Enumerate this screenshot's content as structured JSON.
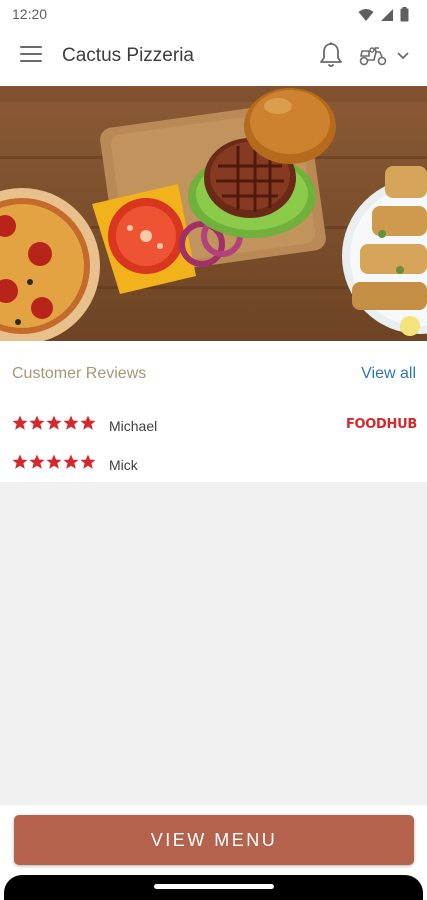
{
  "status_bar": {
    "time": "12:20",
    "icons": [
      "wifi-icon",
      "cellular-signal-icon",
      "battery-icon"
    ]
  },
  "app_bar": {
    "title": "Cactus Pizzeria",
    "icons": [
      "menu-icon",
      "bell-icon",
      "scooter-icon",
      "chevron-down-icon"
    ]
  },
  "hero": {
    "items": [
      "pizza",
      "burger",
      "skewers"
    ]
  },
  "reviews": {
    "title": "Customer Reviews",
    "view_all": "View all",
    "items": [
      {
        "rating": 5,
        "name": "Michael",
        "source": "FOODHUB"
      },
      {
        "rating": 5,
        "name": "Mick",
        "source": ""
      }
    ]
  },
  "footer": {
    "button_label": "VIEW MENU"
  },
  "colors": {
    "accent": "#b5624d",
    "star": "#d6282c",
    "link": "#2f79ad",
    "reviews_title": "#a6977a",
    "background": "#f0f0f0"
  }
}
